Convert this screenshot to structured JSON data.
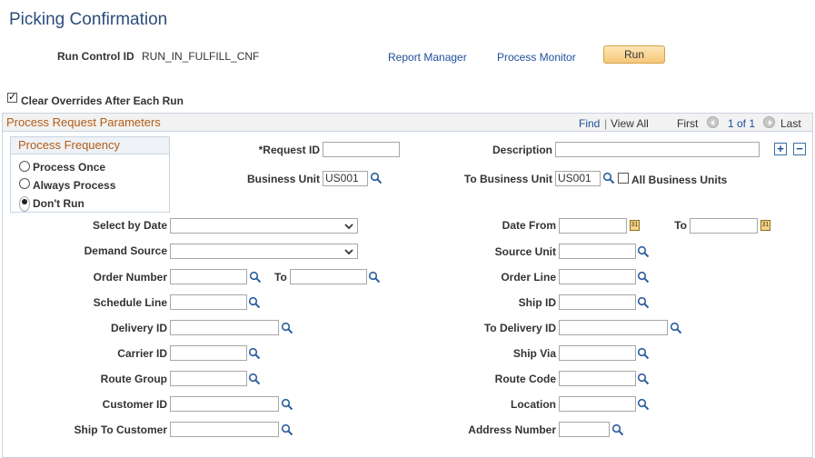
{
  "page": {
    "title": "Picking Confirmation"
  },
  "header": {
    "run_control_label": "Run Control ID",
    "run_control_value": "RUN_IN_FULFILL_CNF",
    "report_manager": "Report Manager",
    "process_monitor": "Process Monitor",
    "run_button": "Run"
  },
  "clear_overrides": {
    "label": "Clear Overrides After Each Run",
    "checked": true
  },
  "panel": {
    "title": "Process Request Parameters",
    "find": "Find",
    "separator": "|",
    "view_all": "View All",
    "first": "First",
    "pager": "1 of 1",
    "last": "Last"
  },
  "frequency": {
    "title": "Process Frequency",
    "options": [
      {
        "label": "Process Once",
        "selected": false
      },
      {
        "label": "Always Process",
        "selected": false
      },
      {
        "label": "Don't Run",
        "selected": true
      }
    ]
  },
  "fields": {
    "request_id": {
      "label": "*Request ID",
      "value": ""
    },
    "description": {
      "label": "Description",
      "value": ""
    },
    "business_unit": {
      "label": "Business Unit",
      "value": "US001"
    },
    "to_business_unit": {
      "label": "To Business Unit",
      "value": "US001"
    },
    "all_business_units": {
      "label": "All Business Units",
      "checked": false
    },
    "select_by_date": {
      "label": "Select by Date",
      "value": ""
    },
    "date_from": {
      "label": "Date From",
      "value": ""
    },
    "date_to": {
      "label": "To",
      "value": ""
    },
    "demand_source": {
      "label": "Demand Source",
      "value": ""
    },
    "source_unit": {
      "label": "Source Unit",
      "value": ""
    },
    "order_number": {
      "label": "Order Number",
      "value": ""
    },
    "order_number_to": {
      "label": "To",
      "value": ""
    },
    "order_line": {
      "label": "Order Line",
      "value": ""
    },
    "schedule_line": {
      "label": "Schedule Line",
      "value": ""
    },
    "ship_id": {
      "label": "Ship ID",
      "value": ""
    },
    "delivery_id": {
      "label": "Delivery ID",
      "value": ""
    },
    "to_delivery_id": {
      "label": "To Delivery ID",
      "value": ""
    },
    "carrier_id": {
      "label": "Carrier ID",
      "value": ""
    },
    "ship_via": {
      "label": "Ship Via",
      "value": ""
    },
    "route_group": {
      "label": "Route Group",
      "value": ""
    },
    "route_code": {
      "label": "Route Code",
      "value": ""
    },
    "customer_id": {
      "label": "Customer ID",
      "value": ""
    },
    "location": {
      "label": "Location",
      "value": ""
    },
    "ship_to_customer": {
      "label": "Ship To Customer",
      "value": ""
    },
    "address_number": {
      "label": "Address Number",
      "value": ""
    }
  },
  "icons": {
    "lookup": "magnifier-icon",
    "calendar": "calendar-icon",
    "dropdown": "chevron-down-icon",
    "add_row": "plus-icon",
    "delete_row": "minus-icon"
  },
  "colors": {
    "title": "#2e4d7b",
    "link": "#1f4e9c",
    "section_title": "#b35c16",
    "run_button": "#f6c77a",
    "border": "#c9d4e0"
  }
}
